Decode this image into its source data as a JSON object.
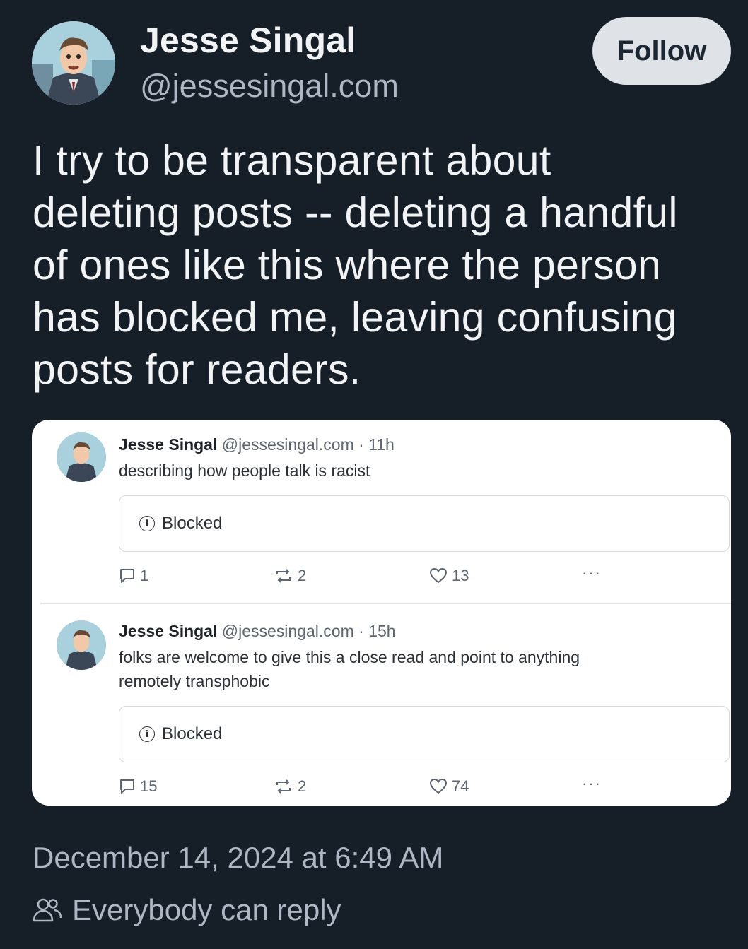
{
  "author": {
    "name": "Jesse Singal",
    "handle": "@jessesingal.com"
  },
  "follow_label": "Follow",
  "post_text_lines": [
    "I try to be transparent about",
    "deleting posts -- deleting a handful",
    "of ones like this where the person",
    "has blocked me, leaving confusing",
    "posts for readers."
  ],
  "embedded_posts": [
    {
      "name": "Jesse Singal",
      "meta": "@jessesingal.com · 11h",
      "text_lines": [
        "describing how people talk is racist"
      ],
      "blocked_label": "Blocked",
      "replies": "1",
      "reposts": "2",
      "likes": "13",
      "more": "···"
    },
    {
      "name": "Jesse Singal",
      "meta": "@jessesingal.com · 15h",
      "text_lines": [
        "folks are welcome to give this a close read and point to anything",
        "remotely transphobic"
      ],
      "blocked_label": "Blocked",
      "replies": "15",
      "reposts": "2",
      "likes": "74",
      "more": "···"
    }
  ],
  "timestamp": "December 14, 2024 at 6:49 AM",
  "reply_setting": "Everybody can reply",
  "icons": {
    "reply": "speech-bubble-icon",
    "repost": "repost-arrows-icon",
    "like": "heart-icon",
    "more": "ellipsis-icon",
    "info": "info-icon",
    "people": "people-icon"
  },
  "colors": {
    "background": "#161e27",
    "text_primary": "#f1f3f5",
    "text_secondary": "#aeb8c4",
    "follow_button": "#dfe3e8"
  }
}
